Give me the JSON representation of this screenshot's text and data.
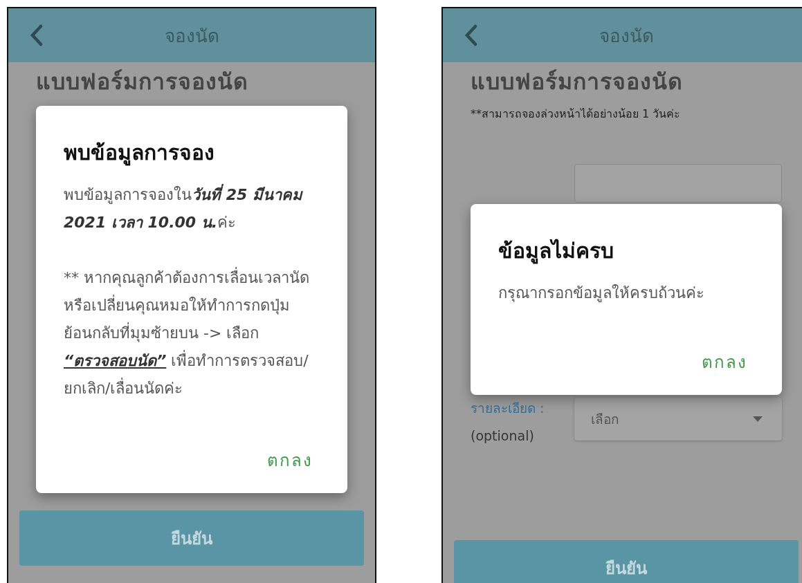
{
  "screens": [
    {
      "header": {
        "title": "จองนัด"
      },
      "heading": "แบบฟอร์มการจองนัด",
      "submit": "ยืนยัน",
      "dialog": {
        "title": "พบข้อมูลการจอง",
        "paragraphs": [
          {
            "kind": "emphasis_text",
            "before": "พบข้อมูลการจองใน",
            "emphasis": "วันที่ 25 มีนาคม 2021 เวลา 10.00 น.",
            "after": "ค่ะ"
          },
          {
            "kind": "link_text",
            "before": "** หากคุณลูกค้าต้องการเลื่อนเวลานัดหรือเปลี่ยนคุณหมอให้ทำการกดปุ่มย้อนกลับที่มุมซ้ายบน -> เลือก ",
            "link": "“ตรวจสอบนัด”",
            "after": " เพื่อทำการตรวจสอบ/ยกเลิก/เลื่อนนัดค่ะ"
          }
        ],
        "button": "ตกลง"
      }
    },
    {
      "header": {
        "title": "จองนัด"
      },
      "heading": "แบบฟอร์มการจองนัด",
      "note": "**สามารถจองล่วงหน้าได้อย่างน้อย 1 วันค่ะ",
      "date_field": true,
      "detail": {
        "label": "รายละเอียด :",
        "hint": "(optional)",
        "value": "เลือก"
      },
      "submit": "ยืนยัน",
      "dialog": {
        "title": "ข้อมูลไม่ครบ",
        "paragraphs": [
          {
            "kind": "text",
            "text": "กรุณากรอกข้อมูลให้ครบถ้วนค่ะ"
          }
        ],
        "button": "ตกลง"
      }
    }
  ]
}
